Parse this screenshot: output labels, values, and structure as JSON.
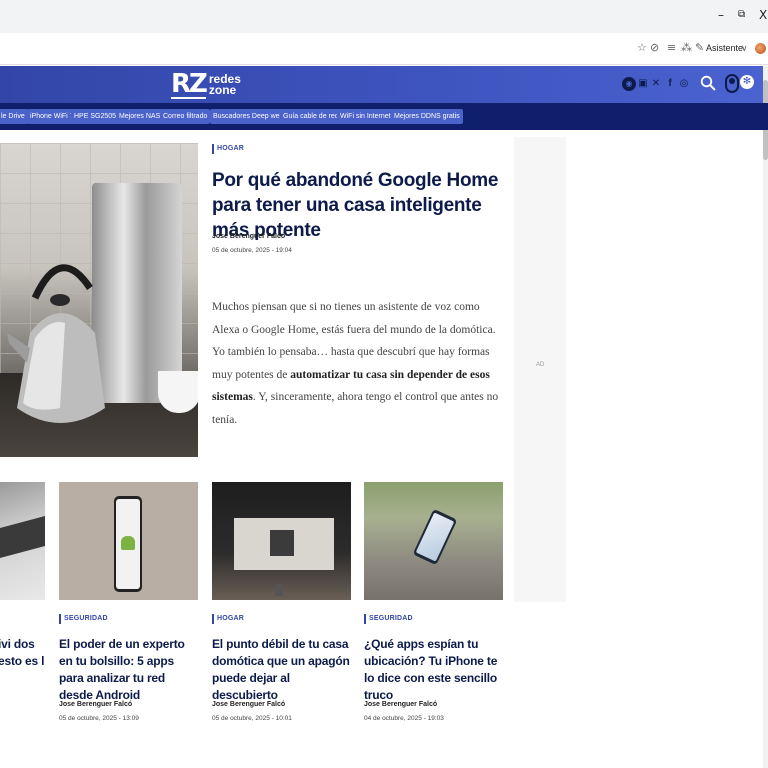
{
  "browser": {
    "minimize_glyph": "–",
    "restore_glyph": "⧉",
    "close_glyph": "X",
    "assistant_label": "Asistente",
    "chevron_glyph": "∨"
  },
  "site": {
    "logo_mark": "RZ",
    "logo_line1": "redes",
    "logo_line2": "zone",
    "tags": [
      "le Drive",
      "iPhone WiFi 7",
      "HPE SG2505P",
      "Mejores NAS",
      "Correo filtrado",
      "Buscadores Deep web",
      "Guía cable de red",
      "WiFi sin Internet",
      "Mejores DDNS gratis"
    ]
  },
  "feature": {
    "category": "HOGAR",
    "title": "Por qué abandoné Google Home para tener una casa inteligente más potente",
    "author": "Jose Berenguer Falcó",
    "date": "05 de octubre, 2025 - 19:04",
    "excerpt_start": "Muchos piensan que si no tienes un asistente de voz como Alexa o Google Home, estás fuera del mundo de la domótica. Yo también lo pensaba… hasta que descubrí que hay formas muy potentes de ",
    "excerpt_bold": "automatizar tu casa sin depender de esos sistemas",
    "excerpt_end": ". Y, sinceramente, ahora tengo el control que antes no tenía."
  },
  "ad": {
    "label": "AD"
  },
  "cards": [
    {
      "title_partial_1": "ivi dos",
      "title_partial_2": "esto es lo"
    },
    {
      "category": "SEGURIDAD",
      "title": "El poder de un experto en tu bolsillo: 5 apps para analizar tu red desde Android",
      "author": "Jose Berenguer Falcó",
      "date": "05 de octubre, 2025 - 13:09"
    },
    {
      "category": "HOGAR",
      "title": "El punto débil de tu casa domótica que un apagón puede dejar al descubierto",
      "author": "Jose Berenguer Falcó",
      "date": "05 de octubre, 2025 - 10:01"
    },
    {
      "category": "SEGURIDAD",
      "title": "¿Qué apps espían tu ubicación? Tu iPhone te lo dice con este sencillo truco",
      "author": "Jose Berenguer Falcó",
      "date": "04 de octubre, 2025 - 19:03"
    }
  ],
  "colors": {
    "brand": "#3f55c0",
    "navy": "#0d1b4a",
    "tag_bg": "#4a62c9",
    "tagbar_bg": "#0f1f6b"
  }
}
